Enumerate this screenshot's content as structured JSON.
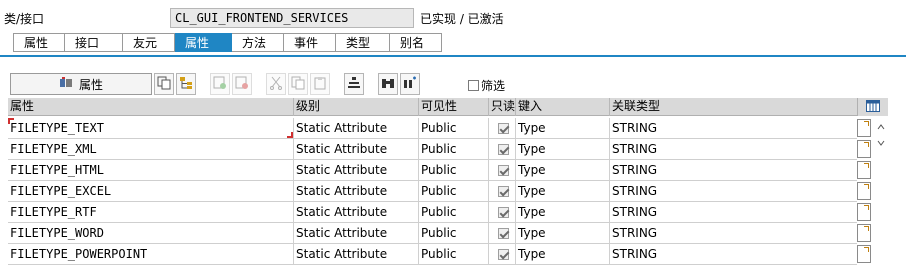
{
  "header": {
    "label": "类/接口",
    "class_name": "CL_GUI_FRONTEND_SERVICES",
    "status": "已实现 / 已激活"
  },
  "tabs": [
    "属性",
    "接口",
    "友元",
    "属性",
    "方法",
    "事件",
    "类型",
    "别名"
  ],
  "active_tab_index": 3,
  "toolbar": {
    "main_button_label": "属性",
    "filter_label": "筛选",
    "buttons": [
      {
        "icon": "copy-icon",
        "enabled": true
      },
      {
        "icon": "tree-icon",
        "enabled": true
      },
      {
        "icon": "insert-row-icon",
        "enabled": false
      },
      {
        "icon": "delete-row-icon",
        "enabled": false
      },
      {
        "icon": "cut-icon",
        "enabled": false
      },
      {
        "icon": "copy-doc-icon",
        "enabled": false
      },
      {
        "icon": "paste-icon",
        "enabled": false
      },
      {
        "icon": "align-icon",
        "enabled": true
      },
      {
        "icon": "binoculars-icon",
        "enabled": true
      },
      {
        "icon": "find-next-icon",
        "enabled": true
      }
    ]
  },
  "table": {
    "columns": [
      "属性",
      "级别",
      "可见性",
      "只读",
      "键入",
      "关联类型"
    ],
    "rows": [
      {
        "name": "FILETYPE_TEXT",
        "level": "Static Attribute",
        "visibility": "Public",
        "readonly": true,
        "typing": "Type",
        "assoc": "STRING"
      },
      {
        "name": "FILETYPE_XML",
        "level": "Static Attribute",
        "visibility": "Public",
        "readonly": true,
        "typing": "Type",
        "assoc": "STRING"
      },
      {
        "name": "FILETYPE_HTML",
        "level": "Static Attribute",
        "visibility": "Public",
        "readonly": true,
        "typing": "Type",
        "assoc": "STRING"
      },
      {
        "name": "FILETYPE_EXCEL",
        "level": "Static Attribute",
        "visibility": "Public",
        "readonly": true,
        "typing": "Type",
        "assoc": "STRING"
      },
      {
        "name": "FILETYPE_RTF",
        "level": "Static Attribute",
        "visibility": "Public",
        "readonly": true,
        "typing": "Type",
        "assoc": "STRING"
      },
      {
        "name": "FILETYPE_WORD",
        "level": "Static Attribute",
        "visibility": "Public",
        "readonly": true,
        "typing": "Type",
        "assoc": "STRING"
      },
      {
        "name": "FILETYPE_POWERPOINT",
        "level": "Static Attribute",
        "visibility": "Public",
        "readonly": true,
        "typing": "Type",
        "assoc": "STRING"
      }
    ]
  },
  "colors": {
    "accent": "#1f86c4",
    "header_bg": "#d9d9d9"
  }
}
